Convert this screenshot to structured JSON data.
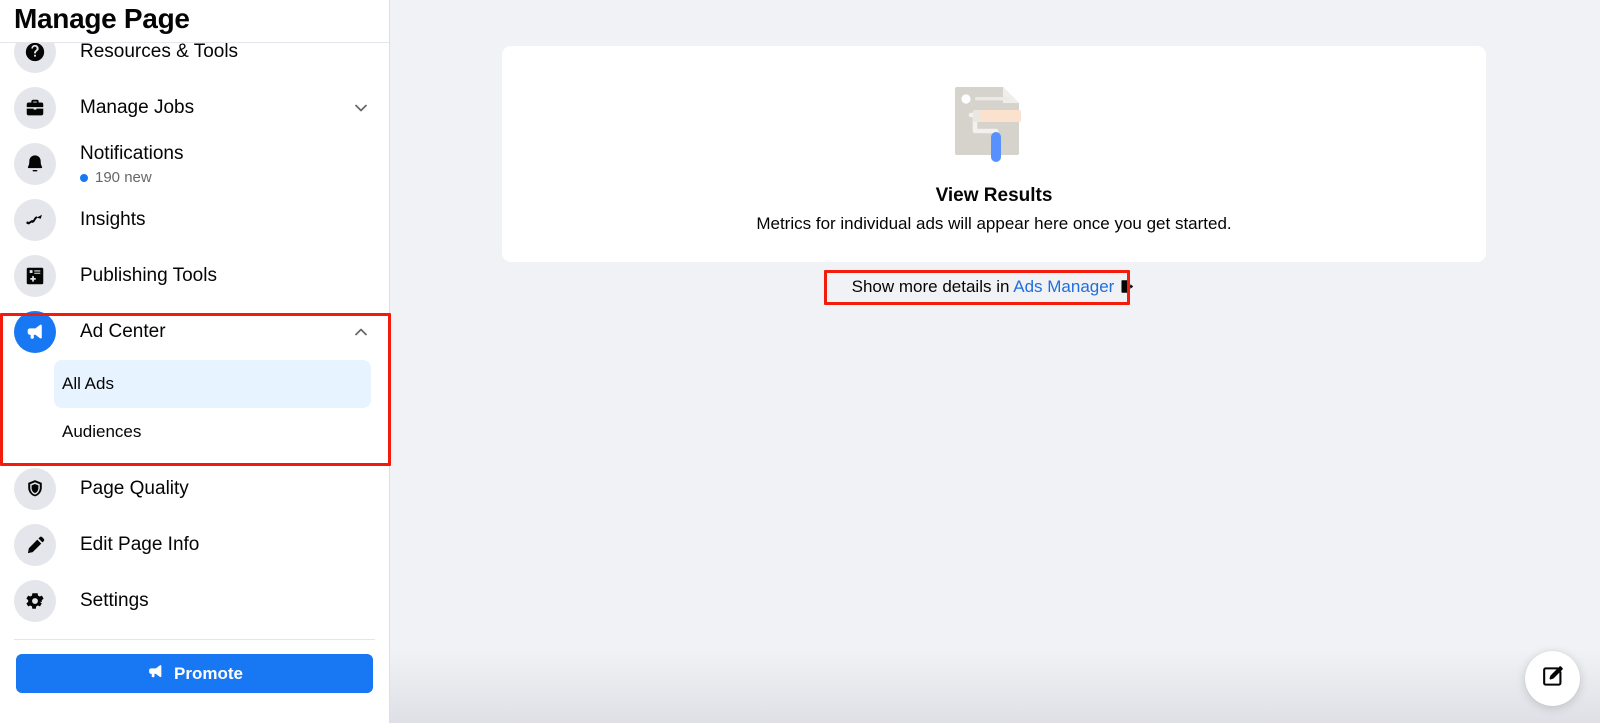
{
  "sidebar": {
    "title": "Manage Page",
    "items": [
      {
        "label": "Resources & Tools",
        "icon": "resources-icon",
        "chevron": false,
        "sub": null
      },
      {
        "label": "Manage Jobs",
        "icon": "briefcase-icon",
        "chevron": "down",
        "sub": null
      },
      {
        "label": "Notifications",
        "icon": "bell-icon",
        "chevron": false,
        "sub": "190 new"
      },
      {
        "label": "Insights",
        "icon": "insights-chart-icon",
        "chevron": false,
        "sub": null
      },
      {
        "label": "Publishing Tools",
        "icon": "publishing-tools-icon",
        "chevron": false,
        "sub": null
      },
      {
        "label": "Ad Center",
        "icon": "megaphone-icon",
        "chevron": "up",
        "sub": null
      },
      {
        "label": "Page Quality",
        "icon": "shield-icon",
        "chevron": false,
        "sub": null
      },
      {
        "label": "Edit Page Info",
        "icon": "pencil-icon",
        "chevron": false,
        "sub": null
      },
      {
        "label": "Settings",
        "icon": "gear-icon",
        "chevron": false,
        "sub": null
      }
    ],
    "ad_center_subitems": [
      {
        "label": "All Ads",
        "active": true
      },
      {
        "label": "Audiences",
        "active": false
      }
    ],
    "promote_label": "Promote",
    "promote_icon": "megaphone-icon"
  },
  "main": {
    "empty_state": {
      "illustration": "paint-roller-document-illustration",
      "title": "View Results",
      "subtitle": "Metrics for individual ads will appear here once you get started."
    },
    "ads_manager": {
      "prefix": "Show more details in ",
      "link_label": "Ads Manager",
      "icon": "external-link-icon"
    },
    "fab": {
      "icon": "compose-edit-icon"
    }
  },
  "colors": {
    "brand_blue": "#1877f2",
    "link_blue": "#216fdb",
    "active_item_bg": "#e7f3ff",
    "annotation_red": "#f31b0c",
    "page_bg": "#f0f2f5",
    "icon_circle_bg": "#e4e6eb"
  }
}
